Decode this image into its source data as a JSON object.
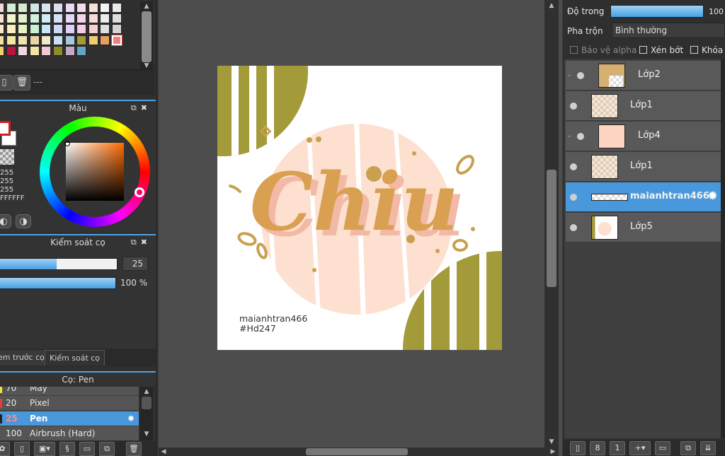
{
  "palette": {
    "rows": [
      [
        "#f6d8d8",
        "#d4ecd4",
        "#d8ead0",
        "#d0e6e6",
        "#d6e4f2",
        "#dcdcf2",
        "#e8dcf2",
        "#f2dcea",
        "#f6e0d8",
        "#f4f4f4",
        "#eaeaea"
      ],
      [
        "#f8e2d0",
        "#f4f4cc",
        "#e2f0cc",
        "#d0f0e0",
        "#d0ecf4",
        "#d8e0f6",
        "#e4d8f6",
        "#f2d4ec",
        "#f8d8d8",
        "#ececec",
        "#dedede"
      ],
      [
        "#fbe8c8",
        "#f8f0c0",
        "#e8f4c0",
        "#c8f0d8",
        "#c8e8f8",
        "#d0d8f8",
        "#e0d0f8",
        "#f8cce8",
        "#f8d0d0",
        "#e0e0e0",
        "#d4d4d4"
      ],
      [
        "#f8dca0",
        "#f4e8a0",
        "#f0e4b0",
        "#ecd4a8",
        "#f0e8c8",
        "#c8e0f0",
        "#a8c8e0",
        "#a69a38",
        "#f2cc70",
        "#e8a060",
        "#f08080"
      ],
      [
        "#f6d070",
        "#b8143c",
        "#f0d8e0",
        "#f4e4a8",
        "#f0c8d8",
        "#8c8c2c",
        "#c4a8c4",
        "#60a8c8"
      ]
    ],
    "selected": "#f08080"
  },
  "swatch_toolbar": {
    "separator_text": "---"
  },
  "color_panel": {
    "title": "Màu",
    "rgb": [
      "255",
      "255",
      "255"
    ],
    "hex": "FFFFFF"
  },
  "brush_control": {
    "title": "Kiểm soát cọ",
    "size_value": "25",
    "size_fill": 0.49,
    "opacity_value": "100 %",
    "opacity_fill": 1.0
  },
  "left_tabs": {
    "preview": "Xem trước cọ",
    "control": "Kiểm soát cọ"
  },
  "brush_list": {
    "title": "Cọ: Pen",
    "items": [
      {
        "size": "70",
        "name": "Máy",
        "mark": "#f2e23a"
      },
      {
        "size": "20",
        "name": "Pixel",
        "mark": "#e83a3a"
      },
      {
        "size": "25",
        "name": "Pen",
        "mark": "#222222",
        "selected": true
      },
      {
        "size": "100",
        "name": "Airbrush (Hard)",
        "mark": "#555555"
      }
    ]
  },
  "artwork": {
    "lettering": "Chiu",
    "credit_line1": "maianhtran466",
    "credit_line2": "#Hd247",
    "colors": {
      "olive": "#a39a3a",
      "peach": "#fde0d0",
      "lettering": "#d8a050",
      "shadow": "#f2b9a6"
    }
  },
  "layer_props": {
    "opacity_label": "Độ trong",
    "opacity_value": "100",
    "opacity_fill": 1.0,
    "blend_label": "Pha trộn",
    "blend_value": "Bình thường",
    "protect_alpha": "Bảo vệ alpha",
    "clipping": "Xén bớt",
    "lock": "Khóa"
  },
  "layers": [
    {
      "name": "Lớp2",
      "indent": true,
      "thumb": "blob-tan"
    },
    {
      "name": "Lớp1",
      "indent": false,
      "thumb": "chiu"
    },
    {
      "name": "Lớp4",
      "indent": true,
      "thumb": "peach"
    },
    {
      "name": "Lớp1",
      "indent": false,
      "thumb": "chiu"
    },
    {
      "name": "maianhtran466",
      "indent": false,
      "thumb": "text",
      "selected": true
    },
    {
      "name": "Lớp5",
      "indent": false,
      "thumb": "design"
    }
  ]
}
